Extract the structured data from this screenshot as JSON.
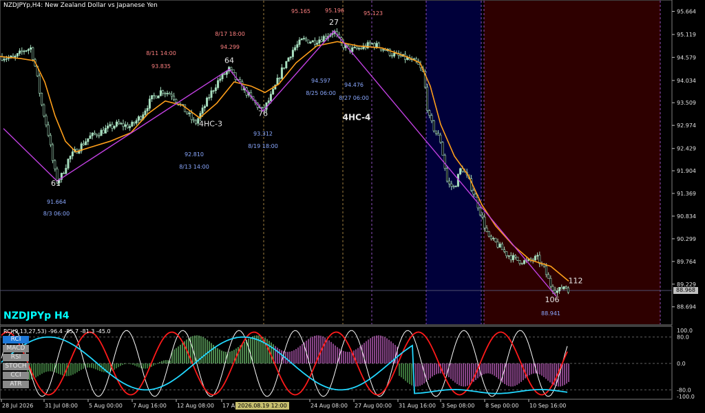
{
  "window": {
    "title": "NZDJPYp,H4:  New Zealand Dollar vs Japanese Yen",
    "symbol_label": "NZDJPYp H4",
    "current_price": "88.968",
    "cursor_date": "2026.08.19 12:00"
  },
  "indicator_panel": {
    "title": "RCI(9,13,27,53) -96.4 -85.7 -81.3 -45.0",
    "buttons": [
      {
        "label": "RCI",
        "active": true
      },
      {
        "label": "MACD",
        "active": false
      },
      {
        "label": "RSI",
        "active": false
      },
      {
        "label": "STOCH",
        "active": false
      },
      {
        "label": "CCI",
        "active": false
      },
      {
        "label": "ATR",
        "active": false
      }
    ],
    "yticks": [
      "100.0",
      "80.0",
      "0.0",
      "-80.0",
      "-100.0"
    ]
  },
  "chart_data": {
    "type": "candlestick",
    "symbol": "NZDJPYp",
    "timeframe": "H4",
    "ylim": [
      88.3,
      95.9
    ],
    "y_ticks": [
      "95.664",
      "95.119",
      "94.579",
      "94.034",
      "93.509",
      "92.974",
      "92.429",
      "91.904",
      "91.369",
      "90.834",
      "90.299",
      "89.764",
      "89.229",
      "88.694"
    ],
    "x_ticks": [
      "28 Jul 2026",
      "31 Jul 08:00",
      "5 Aug 00:00",
      "7 Aug 16:00",
      "12 Aug 08:00",
      "17 Aug",
      "24 Aug 08:00",
      "27 Aug 00:00",
      "31 Aug 16:00",
      "3 Sep 08:00",
      "8 Sep 00:00",
      "10 Sep 16:00"
    ],
    "price_path": [
      [
        0,
        94.6
      ],
      [
        20,
        94.55
      ],
      [
        35,
        94.75
      ],
      [
        45,
        94.8
      ],
      [
        52,
        94.3
      ],
      [
        60,
        93.5
      ],
      [
        70,
        92.8
      ],
      [
        78,
        92.0
      ],
      [
        83,
        91.66
      ],
      [
        90,
        91.8
      ],
      [
        100,
        92.2
      ],
      [
        115,
        92.45
      ],
      [
        130,
        92.7
      ],
      [
        150,
        92.85
      ],
      [
        170,
        93.0
      ],
      [
        190,
        92.95
      ],
      [
        205,
        93.2
      ],
      [
        220,
        93.6
      ],
      [
        235,
        93.8
      ],
      [
        250,
        93.7
      ],
      [
        262,
        93.45
      ],
      [
        275,
        93.2
      ],
      [
        283,
        93.0
      ],
      [
        295,
        93.35
      ],
      [
        305,
        93.7
      ],
      [
        318,
        94.05
      ],
      [
        333,
        94.3
      ],
      [
        345,
        94.0
      ],
      [
        358,
        93.75
      ],
      [
        370,
        93.5
      ],
      [
        382,
        93.31
      ],
      [
        395,
        93.7
      ],
      [
        410,
        94.3
      ],
      [
        425,
        94.75
      ],
      [
        440,
        95.0
      ],
      [
        455,
        94.95
      ],
      [
        470,
        95.05
      ],
      [
        485,
        95.2
      ],
      [
        495,
        94.9
      ],
      [
        510,
        94.75
      ],
      [
        525,
        94.8
      ],
      [
        540,
        94.9
      ],
      [
        555,
        94.8
      ],
      [
        570,
        94.65
      ],
      [
        590,
        94.55
      ],
      [
        605,
        94.45
      ],
      [
        615,
        94.2
      ],
      [
        622,
        93.2
      ],
      [
        630,
        92.9
      ],
      [
        640,
        92.6
      ],
      [
        650,
        91.6
      ],
      [
        660,
        91.5
      ],
      [
        670,
        92.0
      ],
      [
        680,
        91.7
      ],
      [
        690,
        91.3
      ],
      [
        700,
        90.8
      ],
      [
        710,
        90.3
      ],
      [
        720,
        90.2
      ],
      [
        735,
        89.95
      ],
      [
        750,
        89.8
      ],
      [
        765,
        89.75
      ],
      [
        780,
        89.85
      ],
      [
        790,
        89.6
      ],
      [
        800,
        89.2
      ],
      [
        810,
        89.05
      ],
      [
        820,
        89.2
      ],
      [
        826,
        89.1
      ]
    ],
    "ma_path": [
      [
        0,
        94.6
      ],
      [
        30,
        94.55
      ],
      [
        50,
        94.5
      ],
      [
        65,
        94.0
      ],
      [
        80,
        93.2
      ],
      [
        95,
        92.6
      ],
      [
        110,
        92.35
      ],
      [
        130,
        92.45
      ],
      [
        160,
        92.6
      ],
      [
        190,
        92.8
      ],
      [
        215,
        93.25
      ],
      [
        240,
        93.55
      ],
      [
        265,
        93.45
      ],
      [
        290,
        93.15
      ],
      [
        315,
        93.5
      ],
      [
        340,
        94.0
      ],
      [
        365,
        93.9
      ],
      [
        385,
        93.75
      ],
      [
        405,
        93.95
      ],
      [
        430,
        94.45
      ],
      [
        460,
        94.85
      ],
      [
        490,
        94.95
      ],
      [
        520,
        94.85
      ],
      [
        555,
        94.8
      ],
      [
        590,
        94.6
      ],
      [
        610,
        94.45
      ],
      [
        625,
        93.9
      ],
      [
        640,
        93.0
      ],
      [
        660,
        92.25
      ],
      [
        680,
        91.8
      ],
      [
        700,
        91.1
      ],
      [
        720,
        90.6
      ],
      [
        745,
        90.15
      ],
      [
        770,
        89.8
      ],
      [
        800,
        89.65
      ],
      [
        826,
        89.3
      ]
    ],
    "zigzag": [
      [
        5,
        92.9
      ],
      [
        83,
        91.66
      ],
      [
        333,
        94.3
      ],
      [
        382,
        93.31
      ],
      [
        485,
        95.2
      ],
      [
        808,
        88.94
      ]
    ],
    "pivot_labels": [
      {
        "text": "61",
        "x": 81,
        "y": 91.55
      },
      {
        "text": "64",
        "x": 333,
        "y": 94.45
      },
      {
        "text": "76",
        "x": 382,
        "y": 93.2
      },
      {
        "text": "27",
        "x": 485,
        "y": 95.35
      },
      {
        "text": "106",
        "x": 802,
        "y": 88.8
      },
      {
        "text": "112",
        "x": 836,
        "y": 89.25
      },
      {
        "text": "4HC-3",
        "x": 306,
        "y": 92.95
      },
      {
        "text": "4HC-4",
        "x": 518,
        "y": 93.1
      }
    ],
    "annotations_low": [
      {
        "price": "91.664",
        "time": "8/3 06:00",
        "x": 82
      },
      {
        "price": "92.810",
        "time": "8/13 14:00",
        "x": 282
      },
      {
        "price": "93.312",
        "time": "8/19 18:00",
        "x": 382
      },
      {
        "price": "94.597",
        "time": "8/25 06:00",
        "x": 466
      },
      {
        "price": "94.476",
        "time": "8/27 06:00",
        "x": 514
      },
      {
        "price": "88.941",
        "time": "",
        "x": 800
      }
    ],
    "annotations_high": [
      {
        "price": "93.835",
        "time": "8/11 14:00",
        "x": 234
      },
      {
        "price": "94.299",
        "time": "8/17 18:00",
        "x": 334
      },
      {
        "price": "95.165",
        "time": "",
        "x": 437
      },
      {
        "price": "95.196",
        "time": "",
        "x": 486
      },
      {
        "price": "95.123",
        "time": "",
        "x": 542
      }
    ],
    "rci_series": [
      {
        "name": "RCI 9",
        "color": "#ffffff"
      },
      {
        "name": "RCI 13",
        "color": "#ff1a1a"
      },
      {
        "name": "RCI 27",
        "color": "#22d8ff"
      },
      {
        "name": "RCI 53",
        "color": "#b0b0b0"
      }
    ],
    "rci_ylim": [
      -100,
      100
    ],
    "colors": {
      "background": "#000000",
      "bull_candle": "#a8e0c0",
      "ma": "#ff9f1a",
      "zigzag": "#c040e0",
      "blue_zone": "#00004a",
      "red_zone": "#3a0000",
      "annotation_blue": "#8aa8ff",
      "annotation_red": "#ff8080"
    }
  }
}
